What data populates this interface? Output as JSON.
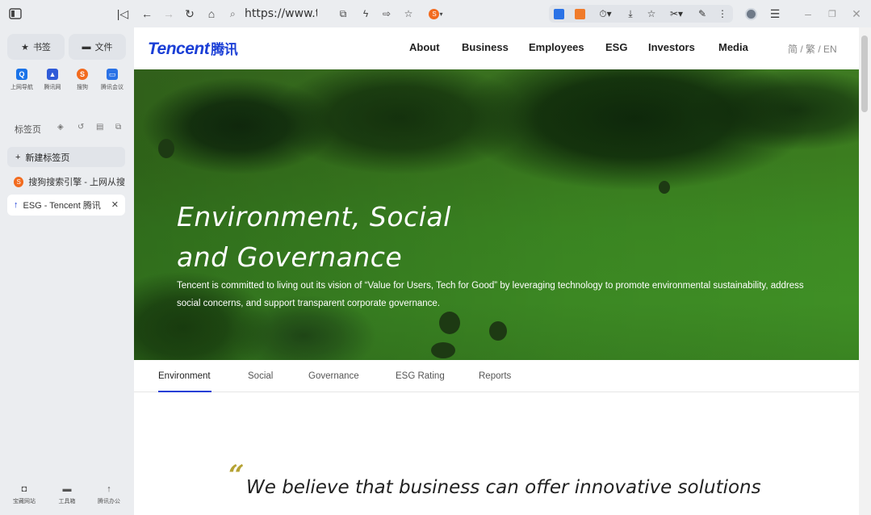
{
  "browser": {
    "url": "https://www.t",
    "ext_badge": "S"
  },
  "sidebar": {
    "bookmarks_label": "书签",
    "files_label": "文件",
    "quick_links": [
      {
        "label": "上网导航",
        "icon": "q-icon",
        "color": "#1a73e8"
      },
      {
        "label": "腾讯网",
        "icon": "tencent-icon",
        "color": "#2f5bd8"
      },
      {
        "label": "搜狗",
        "icon": "sogou-icon",
        "color": "#f26b1f"
      },
      {
        "label": "腾讯会议",
        "icon": "meeting-icon",
        "color": "#2a72e6"
      }
    ],
    "tabs_heading": "标签页",
    "new_tab_label": "新建标签页",
    "tabs": [
      {
        "title": "搜狗搜索引擎 - 上网从搜"
      },
      {
        "title": "ESG - Tencent 腾讯"
      }
    ],
    "bottom_tools": [
      {
        "label": "宝藏网站"
      },
      {
        "label": "工具箱"
      },
      {
        "label": "腾讯办公"
      }
    ]
  },
  "site": {
    "logo_text": "Tencent",
    "logo_cn": "腾讯",
    "nav": [
      "About",
      "Business",
      "Employees",
      "ESG",
      "Investors",
      "Media"
    ],
    "lang": "简 / 繁 / EN",
    "hero_title_line1": "Environment, Social",
    "hero_title_line2": "and Governance",
    "hero_text": "Tencent is committed to living out its vision of “Value for Users, Tech for Good” by leveraging technology to promote environmental sustainability, address social concerns, and support transparent corporate governance.",
    "subnav": [
      "Environment",
      "Social",
      "Governance",
      "ESG Rating",
      "Reports"
    ],
    "active_subnav": "Environment",
    "quote_mark": "“",
    "quote_text": "We believe that business can offer innovative solutions"
  },
  "colors": {
    "brand_blue": "#1b3fd6",
    "quote_gold": "#b5a233"
  }
}
